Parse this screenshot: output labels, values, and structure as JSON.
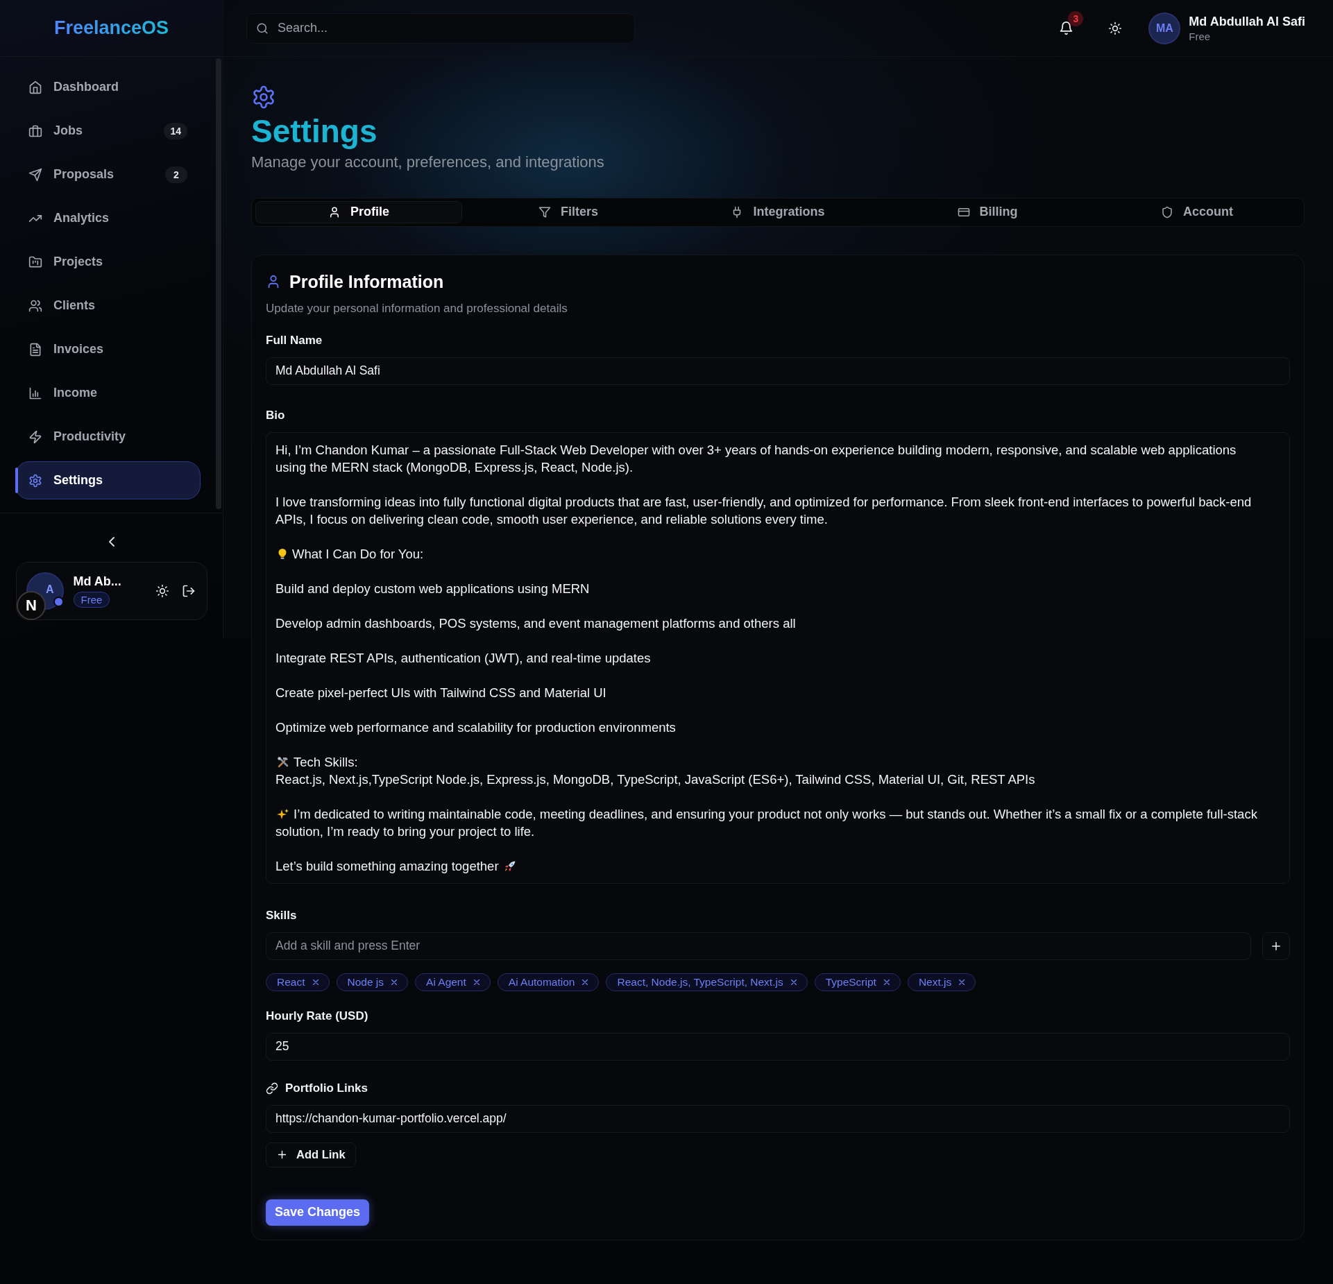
{
  "app": {
    "logo": "FreelanceOS"
  },
  "sidebar": {
    "items": [
      {
        "label": "Dashboard",
        "selected": false
      },
      {
        "label": "Jobs",
        "badge": "14",
        "selected": false
      },
      {
        "label": "Proposals",
        "badge": "2",
        "selected": false
      },
      {
        "label": "Analytics",
        "selected": false
      },
      {
        "label": "Projects",
        "selected": false
      },
      {
        "label": "Clients",
        "selected": false
      },
      {
        "label": "Invoices",
        "selected": false
      },
      {
        "label": "Income",
        "selected": false
      },
      {
        "label": "Productivity",
        "selected": false
      },
      {
        "label": "Settings",
        "selected": true
      }
    ],
    "user_card": {
      "initials": "A",
      "name": "Md Ab...",
      "plan": "Free",
      "online": true
    },
    "dev_badge": "N"
  },
  "header": {
    "search": {
      "placeholder": "Search..."
    },
    "notifications": "3",
    "user": {
      "initials": "MA",
      "name": "Md Abdullah Al Safi",
      "plan": "Free"
    }
  },
  "page": {
    "title": "Settings",
    "subtitle": "Manage your account, preferences, and integrations"
  },
  "tabs": [
    {
      "label": "Profile",
      "selected": true
    },
    {
      "label": "Filters",
      "selected": false
    },
    {
      "label": "Integrations",
      "selected": false
    },
    {
      "label": "Billing",
      "selected": false
    },
    {
      "label": "Account",
      "selected": false
    }
  ],
  "profile": {
    "title": "Profile Information",
    "subtitle": "Update your personal information and professional details",
    "full_name": {
      "label": "Full Name",
      "value": "Md Abdullah Al Safi"
    },
    "bio": {
      "label": "Bio",
      "paragraphs": [
        {
          "kind": "plain",
          "text": "Hi, I’m Chandon Kumar – a passionate Full-Stack Web Developer with over 3+ years of hands-on experience building modern, responsive, and scalable web applications using the MERN stack (MongoDB, Express.js, React, Node.js)."
        },
        {
          "kind": "plain",
          "text": "I love transforming ideas into fully functional digital products that are fast, user-friendly, and optimized for performance. From sleek front-end interfaces to powerful back-end APIs, I focus on delivering clean code, smooth user experience, and reliable solutions every time."
        },
        {
          "kind": "tip",
          "text": "What I Can Do for You:"
        },
        {
          "kind": "plain",
          "text": "Build and deploy custom web applications using MERN"
        },
        {
          "kind": "plain",
          "text": "Develop admin dashboards, POS systems, and event management platforms and others all"
        },
        {
          "kind": "plain",
          "text": "Integrate REST APIs, authentication (JWT), and real-time updates"
        },
        {
          "kind": "plain",
          "text": "Create pixel-perfect UIs with Tailwind CSS and Material UI"
        },
        {
          "kind": "plain",
          "text": "Optimize web performance and scalability for production environments"
        },
        {
          "kind": "tools",
          "text": "Tech Skills:\nReact.js, Next.js,TypeScript Node.js, Express.js, MongoDB, TypeScript, JavaScript (ES6+), Tailwind CSS, Material UI, Git, REST APIs"
        },
        {
          "kind": "sparkle",
          "text": "I’m dedicated to writing maintainable code, meeting deadlines, and ensuring your product not only works — but stands out. Whether it’s a small fix or a complete full-stack solution, I’m ready to bring your project to life."
        },
        {
          "kind": "closing",
          "text": "Let’s build something amazing together"
        }
      ]
    },
    "skills": {
      "label": "Skills",
      "placeholder": "Add a skill and press Enter",
      "tags": [
        "React",
        "Node js",
        "Ai Agent",
        "Ai Automation",
        "React, Node.js, TypeScript, Next.js",
        "TypeScript",
        "Next.js"
      ]
    },
    "hourly_rate": {
      "label": "Hourly Rate (USD)",
      "value": "25"
    },
    "portfolio": {
      "label": "Portfolio Links",
      "links": [
        "https://chandon-kumar-portfolio.vercel.app/"
      ],
      "add_label": "Add Link"
    },
    "save": "Save Changes"
  }
}
